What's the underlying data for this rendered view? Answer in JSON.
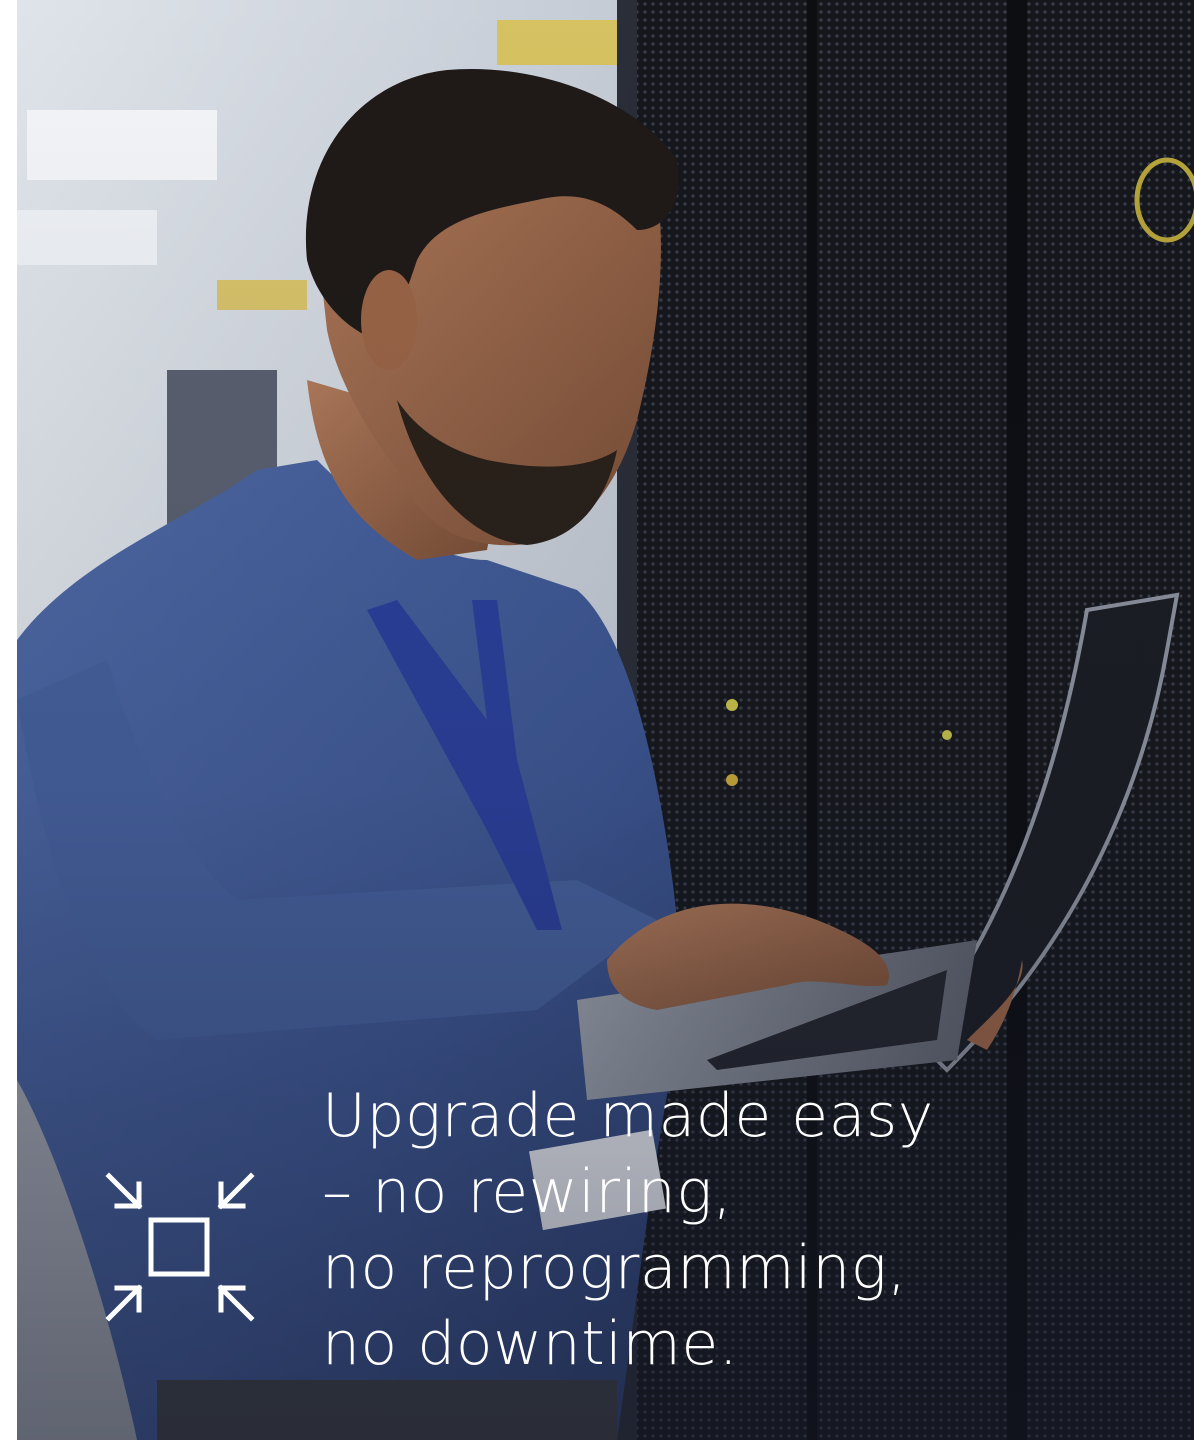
{
  "hero": {
    "headline": {
      "line1": "Upgrade made easy",
      "line2": "– no rewiring,",
      "line3": "no reprogramming,",
      "line4": "no downtime."
    },
    "icon": "collapse-arrows-icon",
    "text_color": "#ffffff"
  }
}
